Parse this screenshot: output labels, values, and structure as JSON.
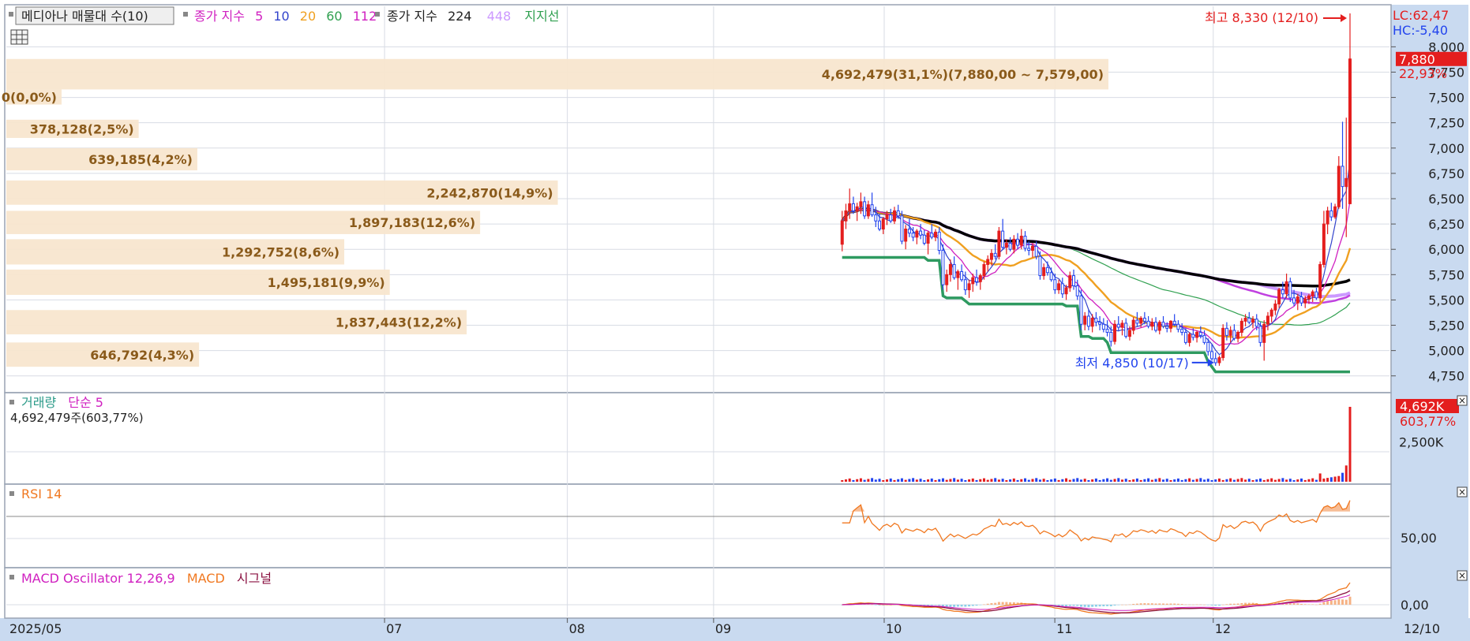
{
  "colors": {
    "up": "#e41e1e",
    "down": "#2244ee",
    "ma5": "#3344cc",
    "ma10": "#d020c0",
    "ma20": "#f0a020",
    "ma60": "#30a050",
    "ma112": "#c040e0",
    "ma224": "#000000",
    "ma448": "#cc99ff",
    "volume_profile": "#f8e6cf",
    "volume_profile_text": "#8a5a1a",
    "rsi": "#f07820",
    "macd_osc": "#d020c0",
    "macd": "#f07820",
    "signal": "#8a1040",
    "axis_bg": "#c9daf0",
    "grid": "#d8dce4"
  },
  "price_panel": {
    "legend": {
      "vp_label": "메디아나 매물대 수(10)",
      "close_ma_label": "종가 지수",
      "ma_periods": [
        "5",
        "10",
        "20",
        "60",
        "112"
      ],
      "close_ma_label_2": "종가 지수",
      "ma_periods_2": [
        "224",
        "448"
      ],
      "support_label": "지지선"
    },
    "lc_label": "LC:62,47",
    "hc_label": "HC:-5,40",
    "current_price": "7,880",
    "current_change": "22,93%",
    "high_label": "최고 8,330 (12/10)",
    "low_label": "최저 4,850 (10/17)"
  },
  "volume_panel": {
    "legend_title": "거래량",
    "legend_ma": "단순 5",
    "value_text": "4,692,479주(603,77%)",
    "current_value": "4,692K",
    "current_pct": "603,77%",
    "axis_tick": "2,500K",
    "close_icon": "×"
  },
  "rsi_panel": {
    "legend": "RSI 14",
    "axis_tick": "50,00",
    "close_icon": "×"
  },
  "macd_panel": {
    "legend_osc": "MACD Oscillator 12,26,9",
    "legend_macd": "MACD",
    "legend_signal": "시그널",
    "axis_tick": "0,00",
    "close_icon": "×"
  },
  "icons": {
    "table_icon": "table-icon"
  },
  "chart_data": {
    "type": "candlestick",
    "title": "",
    "x_axis_labels": [
      "2025/05",
      "07",
      "08",
      "09",
      "10",
      "11",
      "12",
      "12/10"
    ],
    "y_axis": {
      "ticks": [
        "8,000",
        "7,750",
        "7,500",
        "7,250",
        "7,000",
        "6,750",
        "6,500",
        "6,250",
        "6,000",
        "5,750",
        "5,500",
        "5,250",
        "5,000",
        "4,750"
      ],
      "range": [
        4600,
        8400
      ]
    },
    "high": {
      "value": 8330,
      "date": "12/10"
    },
    "low": {
      "value": 4850,
      "date": "10/17"
    },
    "volume_profile": [
      {
        "label": "4,692,479(31,1%)(7,880,00 ~ 7,579,00)",
        "price_low": 7579,
        "price_high": 7880,
        "volume": 4692479,
        "pct": 31.1
      },
      {
        "label": "0(0,0%)",
        "price_low": 7430,
        "price_high": 7579,
        "volume": 0,
        "pct": 0.0
      },
      {
        "label": "378,128(2,5%)",
        "price_low": 7100,
        "price_high": 7280,
        "volume": 378128,
        "pct": 2.5
      },
      {
        "label": "639,185(4,2%)",
        "price_low": 6780,
        "price_high": 7000,
        "volume": 639185,
        "pct": 4.2
      },
      {
        "label": "2,242,870(14,9%)",
        "price_low": 6440,
        "price_high": 6680,
        "volume": 2242870,
        "pct": 14.9
      },
      {
        "label": "1,897,183(12,6%)",
        "price_low": 6150,
        "price_high": 6380,
        "volume": 1897183,
        "pct": 12.6
      },
      {
        "label": "1,292,752(8,6%)",
        "price_low": 5850,
        "price_high": 6100,
        "volume": 1292752,
        "pct": 8.6
      },
      {
        "label": "1,495,181(9,9%)",
        "price_low": 5550,
        "price_high": 5800,
        "volume": 1495181,
        "pct": 9.9
      },
      {
        "label": "1,837,443(12,2%)",
        "price_low": 5160,
        "price_high": 5400,
        "volume": 1837443,
        "pct": 12.2
      },
      {
        "label": "646,792(4,3%)",
        "price_low": 4840,
        "price_high": 5080,
        "volume": 646792,
        "pct": 4.3
      }
    ],
    "candles": [
      {
        "o": 6050,
        "h": 6380,
        "l": 5980,
        "c": 6280
      },
      {
        "o": 6280,
        "h": 6450,
        "l": 6200,
        "c": 6380
      },
      {
        "o": 6380,
        "h": 6600,
        "l": 6300,
        "c": 6450
      },
      {
        "o": 6450,
        "h": 6520,
        "l": 6350,
        "c": 6380
      },
      {
        "o": 6380,
        "h": 6460,
        "l": 6280,
        "c": 6420
      },
      {
        "o": 6420,
        "h": 6560,
        "l": 6350,
        "c": 6470
      },
      {
        "o": 6470,
        "h": 6520,
        "l": 6300,
        "c": 6330
      },
      {
        "o": 6330,
        "h": 6480,
        "l": 6300,
        "c": 6440
      },
      {
        "o": 6440,
        "h": 6560,
        "l": 6320,
        "c": 6340
      },
      {
        "o": 6340,
        "h": 6420,
        "l": 6220,
        "c": 6280
      },
      {
        "o": 6280,
        "h": 6350,
        "l": 6180,
        "c": 6200
      },
      {
        "o": 6200,
        "h": 6320,
        "l": 6150,
        "c": 6300
      },
      {
        "o": 6300,
        "h": 6380,
        "l": 6240,
        "c": 6340
      },
      {
        "o": 6340,
        "h": 6400,
        "l": 6260,
        "c": 6280
      },
      {
        "o": 6280,
        "h": 6420,
        "l": 6250,
        "c": 6380
      },
      {
        "o": 6380,
        "h": 6440,
        "l": 6300,
        "c": 6330
      },
      {
        "o": 6330,
        "h": 6380,
        "l": 6050,
        "c": 6080
      },
      {
        "o": 6080,
        "h": 6240,
        "l": 6000,
        "c": 6200
      },
      {
        "o": 6200,
        "h": 6300,
        "l": 6120,
        "c": 6160
      },
      {
        "o": 6160,
        "h": 6220,
        "l": 6080,
        "c": 6120
      },
      {
        "o": 6120,
        "h": 6200,
        "l": 6050,
        "c": 6180
      },
      {
        "o": 6180,
        "h": 6250,
        "l": 6100,
        "c": 6140
      },
      {
        "o": 6140,
        "h": 6190,
        "l": 6040,
        "c": 6060
      },
      {
        "o": 6060,
        "h": 6180,
        "l": 5950,
        "c": 6160
      },
      {
        "o": 6160,
        "h": 6250,
        "l": 6100,
        "c": 6120
      },
      {
        "o": 6120,
        "h": 6200,
        "l": 6080,
        "c": 6170
      },
      {
        "o": 6170,
        "h": 6220,
        "l": 5950,
        "c": 5990
      },
      {
        "o": 5990,
        "h": 6050,
        "l": 5600,
        "c": 5650
      },
      {
        "o": 5650,
        "h": 5800,
        "l": 5580,
        "c": 5750
      },
      {
        "o": 5750,
        "h": 5900,
        "l": 5680,
        "c": 5850
      },
      {
        "o": 5850,
        "h": 5930,
        "l": 5700,
        "c": 5720
      },
      {
        "o": 5720,
        "h": 5800,
        "l": 5600,
        "c": 5780
      },
      {
        "o": 5780,
        "h": 5850,
        "l": 5680,
        "c": 5700
      },
      {
        "o": 5700,
        "h": 5780,
        "l": 5550,
        "c": 5600
      },
      {
        "o": 5600,
        "h": 5700,
        "l": 5520,
        "c": 5660
      },
      {
        "o": 5660,
        "h": 5760,
        "l": 5580,
        "c": 5720
      },
      {
        "o": 5720,
        "h": 5800,
        "l": 5640,
        "c": 5680
      },
      {
        "o": 5680,
        "h": 5760,
        "l": 5600,
        "c": 5740
      },
      {
        "o": 5740,
        "h": 5880,
        "l": 5700,
        "c": 5850
      },
      {
        "o": 5850,
        "h": 5940,
        "l": 5780,
        "c": 5900
      },
      {
        "o": 5900,
        "h": 6000,
        "l": 5840,
        "c": 5960
      },
      {
        "o": 5960,
        "h": 6050,
        "l": 5900,
        "c": 5930
      },
      {
        "o": 5930,
        "h": 6220,
        "l": 5900,
        "c": 6180
      },
      {
        "o": 6180,
        "h": 6300,
        "l": 6000,
        "c": 6020
      },
      {
        "o": 6020,
        "h": 6100,
        "l": 5950,
        "c": 6060
      },
      {
        "o": 6060,
        "h": 6120,
        "l": 5980,
        "c": 6000
      },
      {
        "o": 6000,
        "h": 6140,
        "l": 5960,
        "c": 6100
      },
      {
        "o": 6100,
        "h": 6160,
        "l": 6000,
        "c": 6040
      },
      {
        "o": 6040,
        "h": 6200,
        "l": 6000,
        "c": 6130
      },
      {
        "o": 6130,
        "h": 6180,
        "l": 5980,
        "c": 6010
      },
      {
        "o": 6010,
        "h": 6080,
        "l": 5940,
        "c": 5990
      },
      {
        "o": 5990,
        "h": 6060,
        "l": 5920,
        "c": 6030
      },
      {
        "o": 6030,
        "h": 6080,
        "l": 5900,
        "c": 5930
      },
      {
        "o": 5930,
        "h": 5980,
        "l": 5700,
        "c": 5740
      },
      {
        "o": 5740,
        "h": 5860,
        "l": 5700,
        "c": 5820
      },
      {
        "o": 5820,
        "h": 5880,
        "l": 5740,
        "c": 5770
      },
      {
        "o": 5770,
        "h": 5820,
        "l": 5680,
        "c": 5700
      },
      {
        "o": 5700,
        "h": 5760,
        "l": 5560,
        "c": 5600
      },
      {
        "o": 5600,
        "h": 5700,
        "l": 5560,
        "c": 5660
      },
      {
        "o": 5660,
        "h": 5720,
        "l": 5520,
        "c": 5560
      },
      {
        "o": 5560,
        "h": 5650,
        "l": 5500,
        "c": 5620
      },
      {
        "o": 5620,
        "h": 5780,
        "l": 5580,
        "c": 5740
      },
      {
        "o": 5740,
        "h": 5800,
        "l": 5600,
        "c": 5640
      },
      {
        "o": 5640,
        "h": 5700,
        "l": 5500,
        "c": 5540
      },
      {
        "o": 5540,
        "h": 5600,
        "l": 5200,
        "c": 5260
      },
      {
        "o": 5260,
        "h": 5380,
        "l": 5200,
        "c": 5340
      },
      {
        "o": 5340,
        "h": 5400,
        "l": 5200,
        "c": 5240
      },
      {
        "o": 5240,
        "h": 5360,
        "l": 5180,
        "c": 5320
      },
      {
        "o": 5320,
        "h": 5380,
        "l": 5240,
        "c": 5280
      },
      {
        "o": 5280,
        "h": 5340,
        "l": 5200,
        "c": 5260
      },
      {
        "o": 5260,
        "h": 5320,
        "l": 5180,
        "c": 5210
      },
      {
        "o": 5210,
        "h": 5300,
        "l": 5140,
        "c": 5180
      },
      {
        "o": 5180,
        "h": 5240,
        "l": 5040,
        "c": 5090
      },
      {
        "o": 5090,
        "h": 5300,
        "l": 5060,
        "c": 5260
      },
      {
        "o": 5260,
        "h": 5340,
        "l": 5200,
        "c": 5230
      },
      {
        "o": 5230,
        "h": 5300,
        "l": 5150,
        "c": 5270
      },
      {
        "o": 5270,
        "h": 5320,
        "l": 5120,
        "c": 5140
      },
      {
        "o": 5140,
        "h": 5240,
        "l": 5100,
        "c": 5200
      },
      {
        "o": 5200,
        "h": 5330,
        "l": 5160,
        "c": 5300
      },
      {
        "o": 5300,
        "h": 5380,
        "l": 5240,
        "c": 5270
      },
      {
        "o": 5270,
        "h": 5340,
        "l": 5230,
        "c": 5320
      },
      {
        "o": 5320,
        "h": 5380,
        "l": 5260,
        "c": 5290
      },
      {
        "o": 5290,
        "h": 5340,
        "l": 5220,
        "c": 5240
      },
      {
        "o": 5240,
        "h": 5320,
        "l": 5200,
        "c": 5280
      },
      {
        "o": 5280,
        "h": 5330,
        "l": 5180,
        "c": 5200
      },
      {
        "o": 5200,
        "h": 5300,
        "l": 5160,
        "c": 5280
      },
      {
        "o": 5280,
        "h": 5340,
        "l": 5220,
        "c": 5240
      },
      {
        "o": 5240,
        "h": 5280,
        "l": 5180,
        "c": 5220
      },
      {
        "o": 5220,
        "h": 5300,
        "l": 5180,
        "c": 5290
      },
      {
        "o": 5290,
        "h": 5360,
        "l": 5240,
        "c": 5260
      },
      {
        "o": 5260,
        "h": 5300,
        "l": 5180,
        "c": 5210
      },
      {
        "o": 5210,
        "h": 5270,
        "l": 5150,
        "c": 5180
      },
      {
        "o": 5180,
        "h": 5220,
        "l": 5060,
        "c": 5080
      },
      {
        "o": 5080,
        "h": 5180,
        "l": 5040,
        "c": 5160
      },
      {
        "o": 5160,
        "h": 5220,
        "l": 5100,
        "c": 5130
      },
      {
        "o": 5130,
        "h": 5200,
        "l": 5080,
        "c": 5180
      },
      {
        "o": 5180,
        "h": 5240,
        "l": 5120,
        "c": 5150
      },
      {
        "o": 5150,
        "h": 5200,
        "l": 5060,
        "c": 5080
      },
      {
        "o": 5080,
        "h": 5120,
        "l": 4950,
        "c": 4990
      },
      {
        "o": 4990,
        "h": 5060,
        "l": 4900,
        "c": 4920
      },
      {
        "o": 4920,
        "h": 4980,
        "l": 4850,
        "c": 4880
      },
      {
        "o": 4880,
        "h": 4950,
        "l": 4850,
        "c": 4930
      },
      {
        "o": 4930,
        "h": 5260,
        "l": 4900,
        "c": 5220
      },
      {
        "o": 5220,
        "h": 5280,
        "l": 5100,
        "c": 5150
      },
      {
        "o": 5150,
        "h": 5240,
        "l": 5080,
        "c": 5200
      },
      {
        "o": 5200,
        "h": 5260,
        "l": 5100,
        "c": 5120
      },
      {
        "o": 5120,
        "h": 5200,
        "l": 5080,
        "c": 5180
      },
      {
        "o": 5180,
        "h": 5320,
        "l": 5140,
        "c": 5290
      },
      {
        "o": 5290,
        "h": 5360,
        "l": 5240,
        "c": 5320
      },
      {
        "o": 5320,
        "h": 5380,
        "l": 5260,
        "c": 5280
      },
      {
        "o": 5280,
        "h": 5340,
        "l": 5220,
        "c": 5310
      },
      {
        "o": 5310,
        "h": 5360,
        "l": 5200,
        "c": 5240
      },
      {
        "o": 5240,
        "h": 5280,
        "l": 5040,
        "c": 5080
      },
      {
        "o": 5080,
        "h": 5300,
        "l": 4900,
        "c": 5260
      },
      {
        "o": 5260,
        "h": 5380,
        "l": 5200,
        "c": 5340
      },
      {
        "o": 5340,
        "h": 5420,
        "l": 5280,
        "c": 5400
      },
      {
        "o": 5400,
        "h": 5500,
        "l": 5350,
        "c": 5460
      },
      {
        "o": 5460,
        "h": 5620,
        "l": 5420,
        "c": 5600
      },
      {
        "o": 5600,
        "h": 5680,
        "l": 5520,
        "c": 5560
      },
      {
        "o": 5560,
        "h": 5760,
        "l": 5520,
        "c": 5680
      },
      {
        "o": 5680,
        "h": 5720,
        "l": 5480,
        "c": 5520
      },
      {
        "o": 5520,
        "h": 5600,
        "l": 5440,
        "c": 5470
      },
      {
        "o": 5470,
        "h": 5560,
        "l": 5400,
        "c": 5530
      },
      {
        "o": 5530,
        "h": 5580,
        "l": 5440,
        "c": 5470
      },
      {
        "o": 5470,
        "h": 5540,
        "l": 5420,
        "c": 5510
      },
      {
        "o": 5510,
        "h": 5560,
        "l": 5460,
        "c": 5540
      },
      {
        "o": 5540,
        "h": 5600,
        "l": 5480,
        "c": 5580
      },
      {
        "o": 5580,
        "h": 5620,
        "l": 5500,
        "c": 5520
      },
      {
        "o": 5520,
        "h": 5880,
        "l": 5480,
        "c": 5850
      },
      {
        "o": 5850,
        "h": 6380,
        "l": 5820,
        "c": 6250
      },
      {
        "o": 6250,
        "h": 6420,
        "l": 6150,
        "c": 6380
      },
      {
        "o": 6380,
        "h": 6460,
        "l": 6280,
        "c": 6320
      },
      {
        "o": 6320,
        "h": 6450,
        "l": 6300,
        "c": 6420
      },
      {
        "o": 6420,
        "h": 6920,
        "l": 6400,
        "c": 6820
      },
      {
        "o": 6820,
        "h": 7260,
        "l": 6400,
        "c": 6620
      },
      {
        "o": 6620,
        "h": 7300,
        "l": 6120,
        "c": 6700
      },
      {
        "o": 6450,
        "h": 8330,
        "l": 6450,
        "c": 7880
      }
    ],
    "series": [
      {
        "name": "5",
        "type": "line"
      },
      {
        "name": "10",
        "type": "line"
      },
      {
        "name": "20",
        "type": "line"
      },
      {
        "name": "60",
        "type": "line"
      },
      {
        "name": "112",
        "type": "line"
      },
      {
        "name": "224",
        "type": "line"
      },
      {
        "name": "448",
        "type": "line"
      }
    ],
    "volume": {
      "ma": "단순 5",
      "last": 4692479,
      "last_pct": 603.77,
      "ticks": [
        "2,500K"
      ]
    },
    "rsi": {
      "period": 14,
      "ticks": [
        "50,00"
      ]
    },
    "macd": {
      "params": "12,26,9",
      "ticks": [
        "0,00"
      ]
    }
  }
}
